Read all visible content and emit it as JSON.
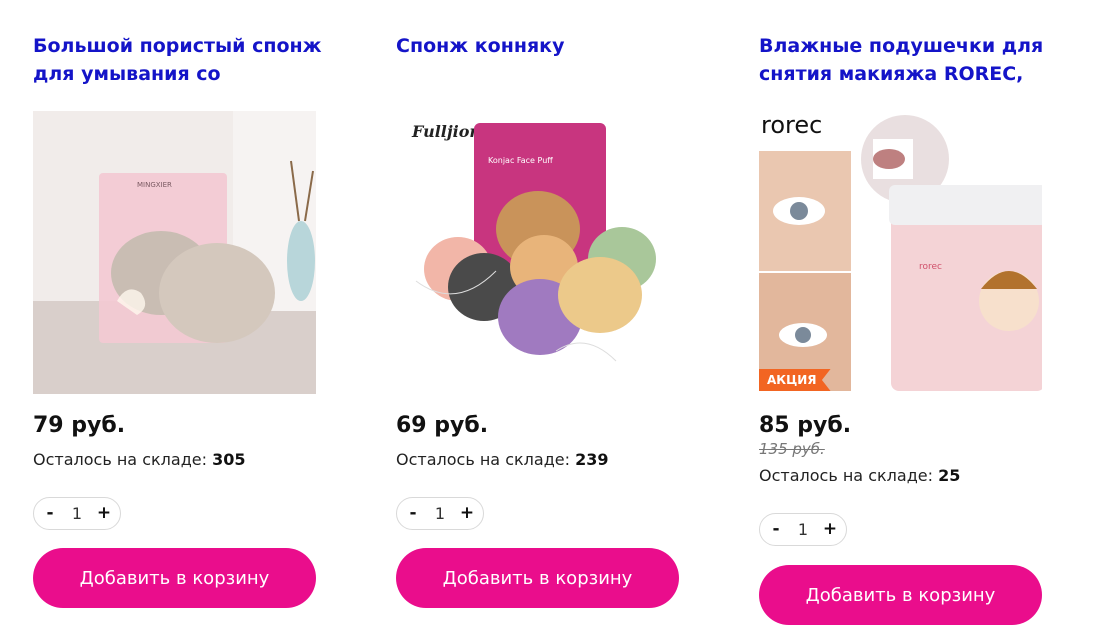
{
  "products": [
    {
      "title": "Большой пористый спонж для умывания со",
      "price": "79 руб.",
      "stock_label": "Осталось на складе: ",
      "stock_count": "305",
      "quantity": "1",
      "minus": "-",
      "plus": "+",
      "cart_label": "Добавить в корзину",
      "brand_text": "MINGXIER"
    },
    {
      "title": "Спонж конняку",
      "price": "69 руб.",
      "stock_label": "Осталось на складе: ",
      "stock_count": "239",
      "quantity": "1",
      "minus": "-",
      "plus": "+",
      "cart_label": "Добавить в корзину",
      "brand_text": "Fulljion",
      "pack_text": "Konjac Face Puff"
    },
    {
      "title": "Влажные подушечки для снятия макияжа ROREC,",
      "price": "85 руб.",
      "old_price": "135 руб.",
      "badge": "АКЦИЯ",
      "stock_label": "Осталось на складе: ",
      "stock_count": "25",
      "quantity": "1",
      "minus": "-",
      "plus": "+",
      "cart_label": "Добавить в корзину",
      "brand_text": "rorec",
      "jar_brand": "rorec"
    }
  ],
  "colors": {
    "title": "#1414c8",
    "cart_button": "#ea0d8c",
    "badge": "#f26522"
  }
}
